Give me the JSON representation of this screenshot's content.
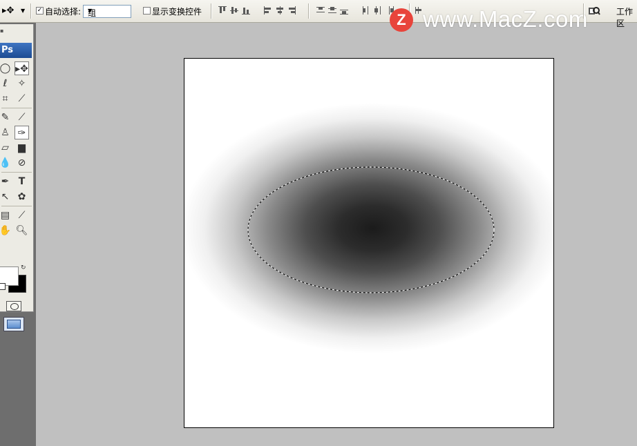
{
  "options_bar": {
    "auto_select_label": "自动选择:",
    "auto_select_checked": true,
    "group_select_value": "组",
    "show_transform_label": "显示变换控件",
    "show_transform_checked": false,
    "workspace_label": "工作区"
  },
  "watermark": {
    "badge_letter": "Z",
    "text": "www.MacZ.com"
  },
  "toolbox": {
    "logo_text": "Ps"
  },
  "colors": {
    "foreground": "#ffffff",
    "background": "#000000",
    "canvas_center": "#1b1b1b",
    "ui_bg": "#c0c0c0"
  }
}
